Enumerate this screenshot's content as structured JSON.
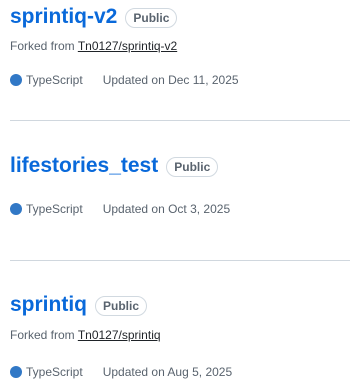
{
  "repositories": [
    {
      "name": "sprintiq-v2",
      "visibility": "Public",
      "forked_prefix": "Forked from",
      "forked_from": "Tn0127/sprintiq-v2",
      "language": "TypeScript",
      "language_color": "#3178c6",
      "updated": "Updated on Dec 11, 2025"
    },
    {
      "name": "lifestories_test",
      "visibility": "Public",
      "language": "TypeScript",
      "language_color": "#3178c6",
      "updated": "Updated on Oct 3, 2025"
    },
    {
      "name": "sprintiq",
      "visibility": "Public",
      "forked_prefix": "Forked from",
      "forked_from": "Tn0127/sprintiq",
      "language": "TypeScript",
      "language_color": "#3178c6",
      "updated": "Updated on Aug 5, 2025"
    }
  ],
  "colors": {
    "link": "#0969da",
    "muted": "#59636e",
    "border": "#d0d7de"
  }
}
